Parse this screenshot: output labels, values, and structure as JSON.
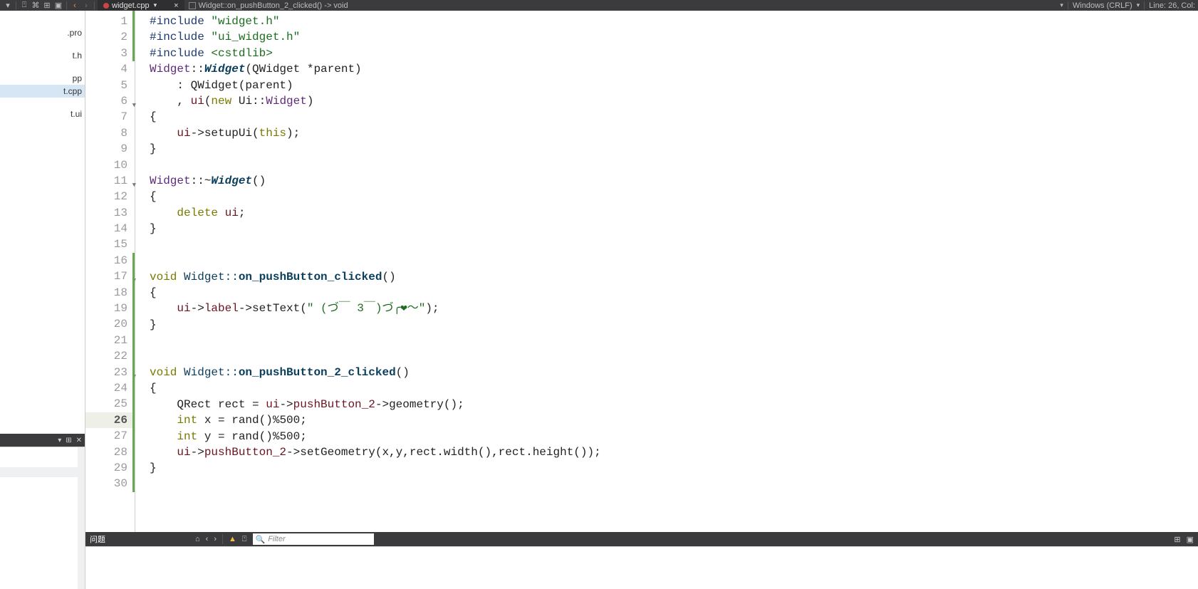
{
  "topbar": {
    "nav_prev": "‹",
    "nav_next": "›",
    "tab_filename": "widget.cpp",
    "tab_dropdown": "▾",
    "tab_close": "×",
    "breadcrumb": "Widget::on_pushButton_2_clicked() -> void",
    "encoding": "Windows (CRLF)",
    "enc_dropdown": "▾",
    "position": "Line: 26, Col:"
  },
  "sidebar": {
    "items": [
      {
        "label": ".pro"
      },
      {
        "label": "t.h"
      },
      {
        "label": "pp"
      },
      {
        "label": "t.cpp"
      },
      {
        "label": "t.ui"
      }
    ],
    "open_docs_dropdown": "▾",
    "open_docs_split": "⊞",
    "open_docs_close": "✕"
  },
  "editor": {
    "lines": [
      {
        "n": 1,
        "fold": false
      },
      {
        "n": 2,
        "fold": false
      },
      {
        "n": 3,
        "fold": false,
        "greenEnd": true
      },
      {
        "n": 4,
        "fold": false
      },
      {
        "n": 5,
        "fold": false
      },
      {
        "n": 6,
        "fold": true
      },
      {
        "n": 7,
        "fold": false
      },
      {
        "n": 8,
        "fold": false
      },
      {
        "n": 9,
        "fold": false
      },
      {
        "n": 10,
        "fold": false
      },
      {
        "n": 11,
        "fold": true
      },
      {
        "n": 12,
        "fold": false
      },
      {
        "n": 13,
        "fold": false
      },
      {
        "n": 14,
        "fold": false
      },
      {
        "n": 15,
        "fold": false
      },
      {
        "n": 16,
        "fold": false,
        "greenStart": true
      },
      {
        "n": 17,
        "fold": true
      },
      {
        "n": 18,
        "fold": false
      },
      {
        "n": 19,
        "fold": false
      },
      {
        "n": 20,
        "fold": false
      },
      {
        "n": 21,
        "fold": false
      },
      {
        "n": 22,
        "fold": false
      },
      {
        "n": 23,
        "fold": true
      },
      {
        "n": 24,
        "fold": false
      },
      {
        "n": 25,
        "fold": false
      },
      {
        "n": 26,
        "fold": false,
        "current": true
      },
      {
        "n": 27,
        "fold": false
      },
      {
        "n": 28,
        "fold": false
      },
      {
        "n": 29,
        "fold": false
      },
      {
        "n": 30,
        "fold": false
      }
    ],
    "code": {
      "l1_pp": "#include ",
      "l1_str": "\"widget.h\"",
      "l2_pp": "#include ",
      "l2_str": "\"ui_widget.h\"",
      "l3_pp": "#include ",
      "l3_inc": "<cstdlib>",
      "l4_a": "Widget",
      "l4_b": "::",
      "l4_c": "Widget",
      "l4_d": "(QWidget *parent)",
      "l5": "    : QWidget(parent)",
      "l6_a": "    , ",
      "l6_b": "ui",
      "l6_c": "(",
      "l6_d": "new",
      "l6_e": " Ui::",
      "l6_f": "Widget",
      "l6_g": ")",
      "l7": "{",
      "l8_a": "    ",
      "l8_b": "ui",
      "l8_c": "->setupUi(",
      "l8_d": "this",
      "l8_e": ");",
      "l9": "}",
      "l10": "",
      "l11_a": "Widget",
      "l11_b": "::~",
      "l11_c": "Widget",
      "l11_d": "()",
      "l12": "{",
      "l13_a": "    ",
      "l13_b": "delete",
      "l13_c": " ",
      "l13_d": "ui",
      "l13_e": ";",
      "l14": "}",
      "l15": "",
      "l16": "",
      "l17_a": "void",
      "l17_b": " Widget::",
      "l17_c": "on_pushButton_clicked",
      "l17_d": "()",
      "l18": "{",
      "l19_a": "    ",
      "l19_b": "ui",
      "l19_c": "->",
      "l19_d": "label",
      "l19_e": "->setText(",
      "l19_f": "\" (づ￣ 3￣)づ╭❤～\"",
      "l19_g": ");",
      "l20": "}",
      "l21": "",
      "l22": "",
      "l23_a": "void",
      "l23_b": " Widget::",
      "l23_c": "on_pushButton_2_clicked",
      "l23_d": "()",
      "l24": "{",
      "l25_a": "    QRect rect = ",
      "l25_b": "ui",
      "l25_c": "->",
      "l25_d": "pushButton_2",
      "l25_e": "->geometry();",
      "l26_a": "    ",
      "l26_b": "int",
      "l26_c": " x = rand()%500;",
      "l27_a": "    ",
      "l27_b": "int",
      "l27_c": " y = rand()%500;",
      "l28_a": "    ",
      "l28_b": "ui",
      "l28_c": "->",
      "l28_d": "pushButton_2",
      "l28_e": "->setGeometry(x,y,rect.width(),rect.height());",
      "l29": "}",
      "l30": ""
    }
  },
  "bottombar": {
    "issues_label": "问题",
    "filter_placeholder": "Filter"
  }
}
